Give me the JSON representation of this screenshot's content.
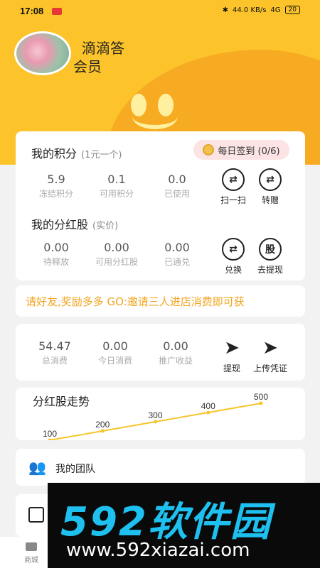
{
  "status": {
    "time": "17:08",
    "network": "44.0 KB/s",
    "signal": "4G",
    "battery": "20"
  },
  "profile": {
    "name": "滴滴答",
    "tag": "会员"
  },
  "points": {
    "title": "我的积分",
    "subtitle": "(1元一个)",
    "signin": "每日签到 (0/6)",
    "stats": [
      {
        "value": "5.9",
        "label": "冻结积分"
      },
      {
        "value": "0.1",
        "label": "可用积分"
      },
      {
        "value": "0.0",
        "label": "已使用"
      }
    ],
    "actions": [
      {
        "icon": "exchange-icon",
        "label": "扫一扫"
      },
      {
        "icon": "exchange-icon",
        "label": "转赠"
      }
    ]
  },
  "dividend": {
    "title": "我的分红股",
    "subtitle": "(实价)",
    "stats": [
      {
        "value": "0.00",
        "label": "待释放"
      },
      {
        "value": "0.00",
        "label": "可用分红股"
      },
      {
        "value": "0.00",
        "label": "已通兑"
      }
    ],
    "actions": [
      {
        "icon": "exchange-icon",
        "label": "兑换"
      },
      {
        "icon": "ribbon-icon",
        "glyph": "股",
        "label": "去提现"
      }
    ]
  },
  "marquee": "请好友,奖励多多 GO:邀请三人进店消费即可获",
  "consume": {
    "stats": [
      {
        "value": "54.47",
        "label": "总消费"
      },
      {
        "value": "0.00",
        "label": "今日消费"
      },
      {
        "value": "0.00",
        "label": "推广收益"
      }
    ],
    "actions": [
      {
        "icon": "send-icon",
        "label": "提现"
      },
      {
        "icon": "send-icon",
        "label": "上传凭证"
      }
    ]
  },
  "chart_data": {
    "type": "line",
    "title": "分红股走势",
    "x": [
      0,
      1,
      2,
      3,
      4
    ],
    "values": [
      100,
      200,
      300,
      400,
      500
    ],
    "labels": [
      "100",
      "200",
      "300",
      "400",
      "500"
    ],
    "color": "#f7c52b"
  },
  "team": {
    "label": "我的团队"
  },
  "tabbar": {
    "items": [
      {
        "label": "商城"
      }
    ]
  },
  "watermark": {
    "brand": "592软件园",
    "url": "www.592xiazai.com"
  }
}
